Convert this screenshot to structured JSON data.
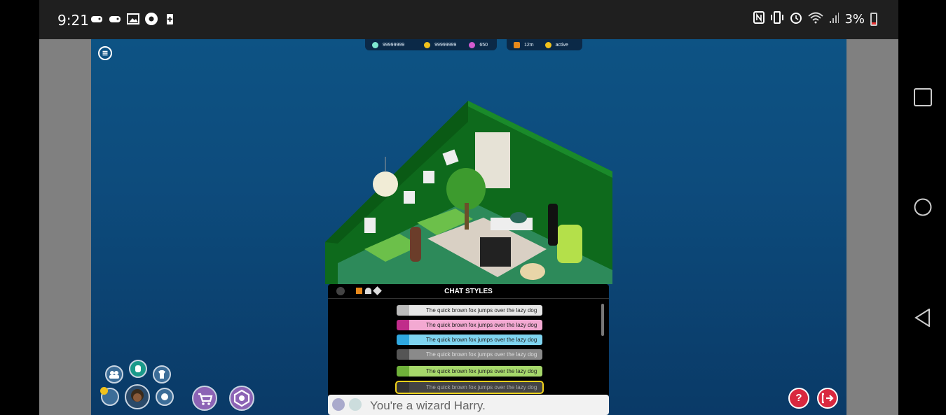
{
  "statusbar": {
    "time": "9:21",
    "battery": "3%",
    "left_icons": [
      "game-controller-icon",
      "game-controller-icon",
      "image-icon",
      "chrome-icon",
      "battery-saver-icon"
    ],
    "right_icons": [
      "nfc-icon",
      "vibrate-icon",
      "alarm-icon",
      "wifi-icon",
      "signal-icon"
    ]
  },
  "hud": {
    "diamonds": "99999999",
    "credits": "99999999",
    "duckets": "650",
    "time_online": "12m",
    "status": "active"
  },
  "chat_styles": {
    "title": "CHAT STYLES",
    "sample": "The quick brown fox jumps over the lazy dog",
    "styles": [
      {
        "name": "normal",
        "bg": "#e6e6e6",
        "accent": "#bbbbbb"
      },
      {
        "name": "pink",
        "bg": "#f3a9d2",
        "accent": "#c02c8a"
      },
      {
        "name": "cyan",
        "bg": "#7fd4f0",
        "accent": "#2fa8e0"
      },
      {
        "name": "grey",
        "bg": "#8a8a8a",
        "accent": "#555555"
      },
      {
        "name": "green",
        "bg": "#a6d86b",
        "accent": "#6fb13a"
      },
      {
        "name": "dark",
        "bg": "#444444",
        "accent": "#333333"
      }
    ],
    "selected_index": 5
  },
  "chat_input": {
    "value": "You're a wizard Harry."
  },
  "colors": {
    "accent_purple": "#8c63b5",
    "danger_red": "#d9283f",
    "select_yellow": "#f2d21b"
  }
}
